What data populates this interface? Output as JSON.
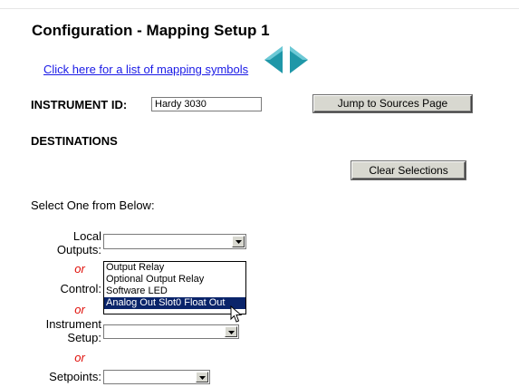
{
  "header": {
    "title": "Configuration - Mapping Setup 1",
    "symbols_link": "Click here for a list of mapping symbols"
  },
  "instrument": {
    "label": "INSTRUMENT ID:",
    "value": "Hardy 3030",
    "jump_button": "Jump to Sources Page"
  },
  "destinations": {
    "heading": "DESTINATIONS",
    "clear_button": "Clear Selections",
    "instruction": "Select One from Below:",
    "or_text": "or",
    "local_outputs": {
      "label_line1": "Local",
      "label_line2": "Outputs:",
      "value": "",
      "options": [
        "Output Relay",
        "Optional Output Relay",
        "Software LED",
        "Analog Out Slot0 Float Out"
      ],
      "highlighted_option": "Analog Out Slot0 Float Out"
    },
    "control": {
      "label": "Control:"
    },
    "instrument_setup": {
      "label_line1": "Instrument",
      "label_line2": "Setup:",
      "value": ""
    },
    "setpoints": {
      "label": "Setpoints:",
      "value": ""
    }
  },
  "colors": {
    "link": "#1a1ae6",
    "or_text": "#e0100a",
    "nav_arrow": "#1f97a8",
    "option_highlight": "#0a246a"
  },
  "icons": [
    "prev-arrow-icon",
    "next-arrow-icon",
    "dropdown-arrow-icon",
    "mouse-pointer-icon"
  ]
}
